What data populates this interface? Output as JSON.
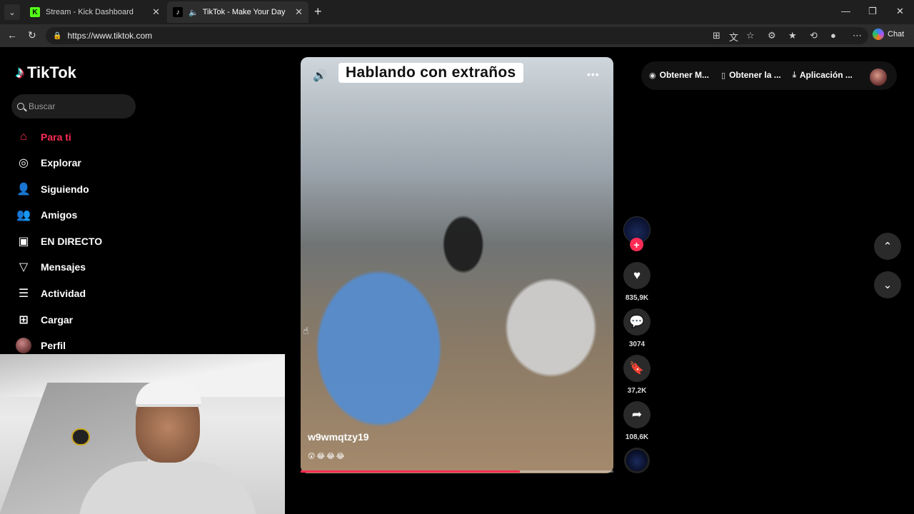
{
  "browser": {
    "tabs": [
      {
        "title": "Stream - Kick Dashboard",
        "favicon": "kick-icon"
      },
      {
        "title": "TikTok - Make Your Day",
        "favicon": "tiktok-icon",
        "active": true
      }
    ],
    "url": "https://www.tiktok.com",
    "chat_label": "Chat"
  },
  "sidebar": {
    "logo": "TikTok",
    "search_placeholder": "Buscar",
    "items": [
      {
        "label": "Para ti",
        "icon": "home-icon",
        "active": true
      },
      {
        "label": "Explorar",
        "icon": "compass-icon"
      },
      {
        "label": "Siguiendo",
        "icon": "user-follow-icon"
      },
      {
        "label": "Amigos",
        "icon": "friends-icon"
      },
      {
        "label": "EN DIRECTO",
        "icon": "live-icon"
      },
      {
        "label": "Mensajes",
        "icon": "send-icon"
      },
      {
        "label": "Actividad",
        "icon": "activity-icon"
      },
      {
        "label": "Cargar",
        "icon": "upload-icon"
      },
      {
        "label": "Perfil",
        "icon": "avatar"
      }
    ]
  },
  "video": {
    "title": "Hablando con extraños",
    "author": "w9wmqtzy19",
    "caption_emojis": "😲😂😂😂",
    "progress": 0.7
  },
  "actions": {
    "likes": "835,9K",
    "comments": "3074",
    "saves": "37,2K",
    "shares": "108,6K"
  },
  "header": {
    "items": [
      {
        "label": "Obtener M...",
        "icon": "coin-icon"
      },
      {
        "label": "Obtener la ...",
        "icon": "phone-icon"
      },
      {
        "label": "Aplicación ...",
        "icon": "download-icon"
      }
    ]
  },
  "colors": {
    "accent": "#fe2c55",
    "background": "#000000"
  }
}
